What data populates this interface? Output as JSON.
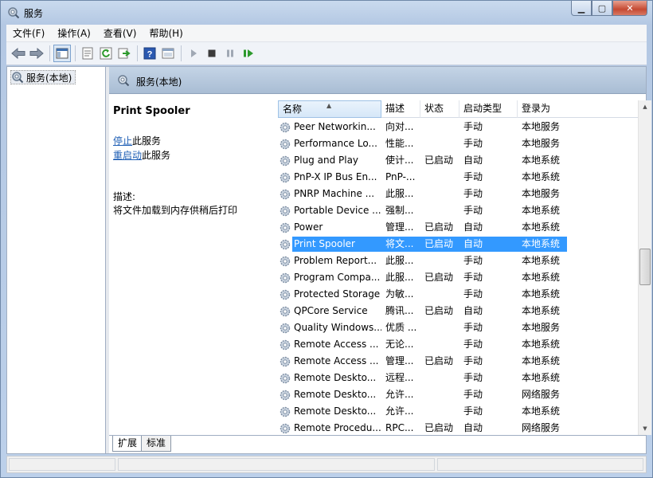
{
  "window": {
    "title": "服务",
    "minimize_glyph": "▁",
    "maximize_glyph": "▢",
    "close_glyph": "✕"
  },
  "menu": [
    {
      "label": "文件(F)"
    },
    {
      "label": "操作(A)"
    },
    {
      "label": "查看(V)"
    },
    {
      "label": "帮助(H)"
    }
  ],
  "toolbar": {
    "icons": [
      "back-icon",
      "forward-icon",
      "console-tree-icon",
      "properties-icon",
      "refresh-icon",
      "export-icon",
      "help-icon",
      "view-icon",
      "start-service-icon",
      "stop-service-icon",
      "pause-service-icon",
      "restart-service-icon"
    ]
  },
  "tree": {
    "root_label": "服务(本地)"
  },
  "panel": {
    "title": "服务(本地)"
  },
  "details": {
    "service_name": "Print Spooler",
    "stop_link": "停止",
    "stop_suffix": "此服务",
    "restart_link": "重启动",
    "restart_suffix": "此服务",
    "description_label": "描述:",
    "description_text": "将文件加载到内存供稍后打印"
  },
  "columns": {
    "name": "名称",
    "description": "描述",
    "status": "状态",
    "startup_type": "启动类型",
    "logon_as": "登录为",
    "sort_arrow": "▲"
  },
  "rows": [
    {
      "name": "Peer Networkin...",
      "desc": "向对...",
      "status": "",
      "startup": "手动",
      "logon": "本地服务"
    },
    {
      "name": "Performance Lo...",
      "desc": "性能...",
      "status": "",
      "startup": "手动",
      "logon": "本地服务"
    },
    {
      "name": "Plug and Play",
      "desc": "使计...",
      "status": "已启动",
      "startup": "自动",
      "logon": "本地系统"
    },
    {
      "name": "PnP-X IP Bus En...",
      "desc": "PnP-...",
      "status": "",
      "startup": "手动",
      "logon": "本地系统"
    },
    {
      "name": "PNRP Machine ...",
      "desc": "此服...",
      "status": "",
      "startup": "手动",
      "logon": "本地服务"
    },
    {
      "name": "Portable Device ...",
      "desc": "强制...",
      "status": "",
      "startup": "手动",
      "logon": "本地系统"
    },
    {
      "name": "Power",
      "desc": "管理...",
      "status": "已启动",
      "startup": "自动",
      "logon": "本地系统"
    },
    {
      "name": "Print Spooler",
      "desc": "将文...",
      "status": "已启动",
      "startup": "自动",
      "logon": "本地系统",
      "selected": true
    },
    {
      "name": "Problem Report...",
      "desc": "此服...",
      "status": "",
      "startup": "手动",
      "logon": "本地系统"
    },
    {
      "name": "Program Compa...",
      "desc": "此服...",
      "status": "已启动",
      "startup": "手动",
      "logon": "本地系统"
    },
    {
      "name": "Protected Storage",
      "desc": "为敏...",
      "status": "",
      "startup": "手动",
      "logon": "本地系统"
    },
    {
      "name": "QPCore Service",
      "desc": "腾讯...",
      "status": "已启动",
      "startup": "自动",
      "logon": "本地系统"
    },
    {
      "name": "Quality Windows...",
      "desc": "优质 ...",
      "status": "",
      "startup": "手动",
      "logon": "本地服务"
    },
    {
      "name": "Remote Access ...",
      "desc": "无论...",
      "status": "",
      "startup": "手动",
      "logon": "本地系统"
    },
    {
      "name": "Remote Access ...",
      "desc": "管理...",
      "status": "已启动",
      "startup": "手动",
      "logon": "本地系统"
    },
    {
      "name": "Remote Deskto...",
      "desc": "远程...",
      "status": "",
      "startup": "手动",
      "logon": "本地系统"
    },
    {
      "name": "Remote Deskto...",
      "desc": "允许...",
      "status": "",
      "startup": "手动",
      "logon": "网络服务"
    },
    {
      "name": "Remote Deskto...",
      "desc": "允许...",
      "status": "",
      "startup": "手动",
      "logon": "本地系统"
    },
    {
      "name": "Remote Procedu...",
      "desc": "RPC...",
      "status": "已启动",
      "startup": "自动",
      "logon": "网络服务"
    }
  ],
  "scrollbar": {
    "up_glyph": "▲",
    "down_glyph": "▼"
  },
  "tabs": [
    {
      "label": "扩展",
      "active": true
    },
    {
      "label": "标准",
      "active": false
    }
  ]
}
